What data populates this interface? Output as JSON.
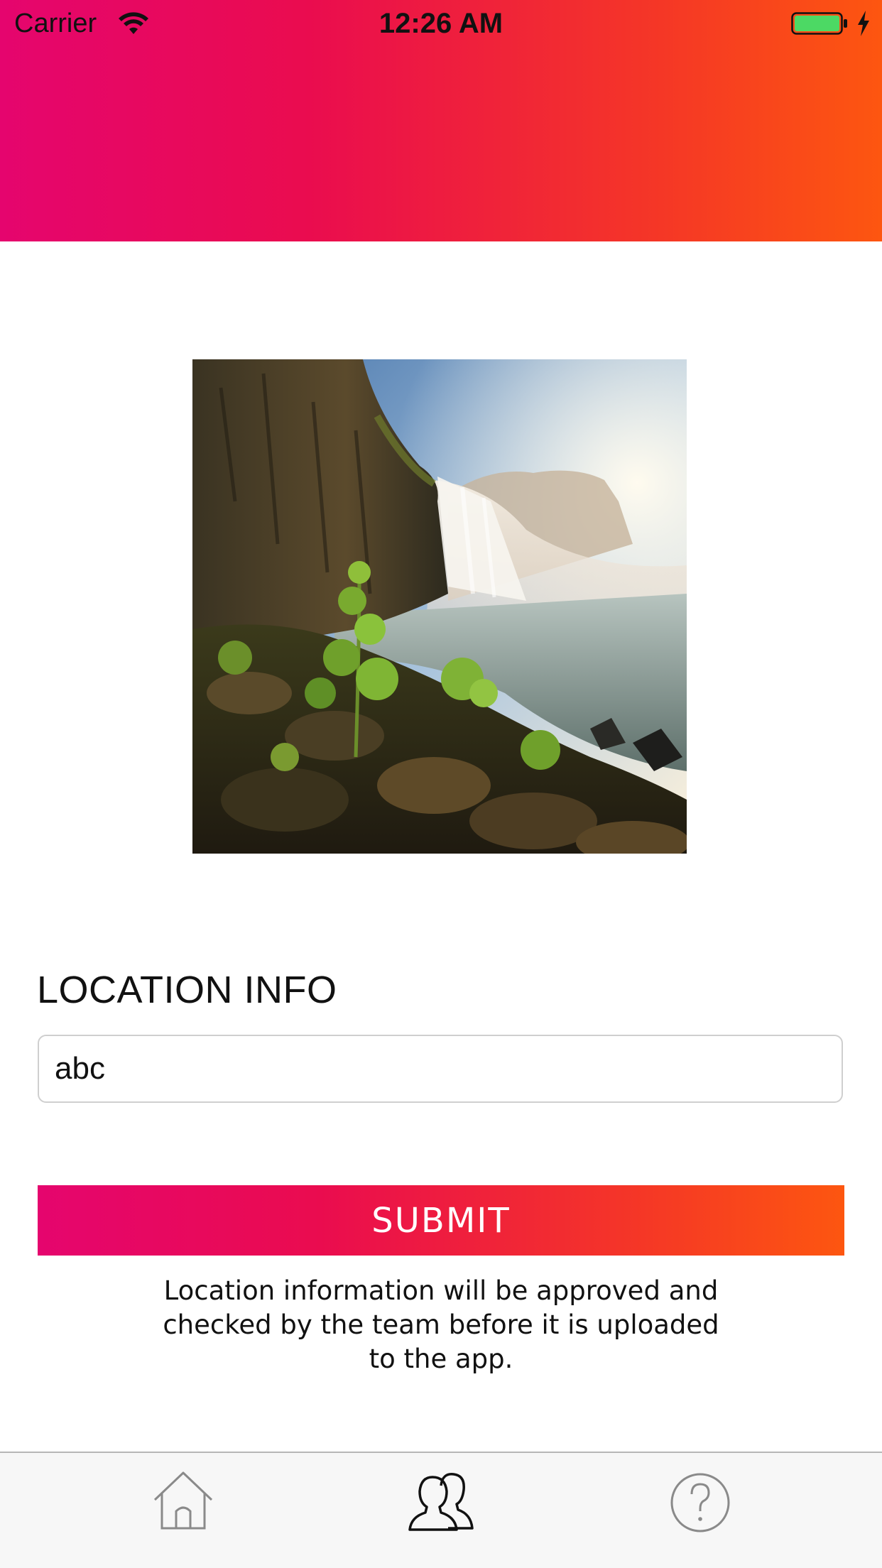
{
  "status_bar": {
    "carrier": "Carrier",
    "time": "12:26 AM",
    "wifi_icon": "wifi-icon",
    "battery_icon": "battery-icon",
    "charging_icon": "charging-bolt-icon"
  },
  "header": {
    "gradient_start": "#e5056e",
    "gradient_end": "#fd5610"
  },
  "photo": {
    "subject": "waterfall-landscape-image"
  },
  "form": {
    "section_label": "LOCATION INFO",
    "location_value": "abc",
    "submit_label": "SUBMIT",
    "note": "Location information will be approved and checked by the team before it is uploaded to the app."
  },
  "tab_bar": {
    "tabs": [
      {
        "icon": "home-icon",
        "active": false
      },
      {
        "icon": "users-icon",
        "active": true
      },
      {
        "icon": "help-icon",
        "active": false
      }
    ]
  },
  "colors": {
    "accent_pink": "#e5056e",
    "accent_orange": "#fd5610",
    "battery_green": "#4cd964"
  }
}
